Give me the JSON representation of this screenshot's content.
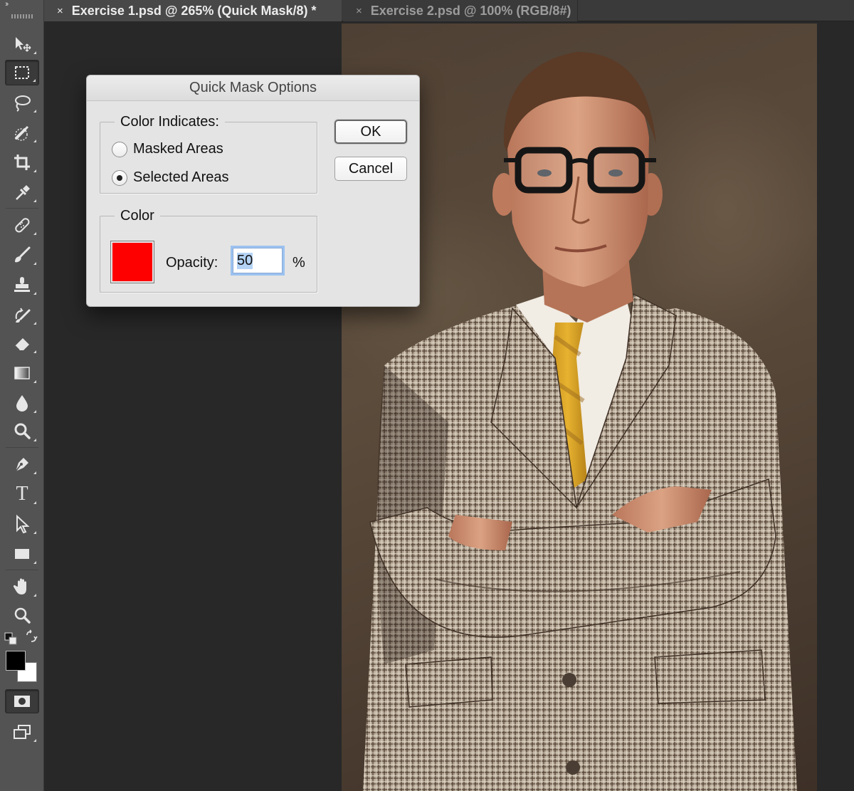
{
  "tabs": [
    {
      "title": "Exercise 1.psd @ 265% (Quick Mask/8) *",
      "close": "×",
      "active": true
    },
    {
      "title": "Exercise 2.psd @ 100% (RGB/8#)",
      "close": "×",
      "active": false
    }
  ],
  "toolbar": {
    "collapse": "››",
    "tools": [
      {
        "name": "move-icon"
      },
      {
        "name": "marquee-icon",
        "active": true
      },
      {
        "name": "lasso-icon"
      },
      {
        "name": "quick-selection-icon"
      },
      {
        "name": "crop-icon"
      },
      {
        "name": "eyedropper-icon"
      },
      {
        "name": "healing-brush-icon"
      },
      {
        "name": "brush-icon"
      },
      {
        "name": "clone-stamp-icon"
      },
      {
        "name": "history-brush-icon"
      },
      {
        "name": "eraser-icon"
      },
      {
        "name": "gradient-icon"
      },
      {
        "name": "blur-icon"
      },
      {
        "name": "dodge-icon"
      },
      {
        "name": "pen-icon"
      },
      {
        "name": "type-icon",
        "glyph": "T"
      },
      {
        "name": "path-selection-icon"
      },
      {
        "name": "rectangle-icon"
      },
      {
        "name": "hand-icon"
      },
      {
        "name": "zoom-icon"
      }
    ],
    "foreground_color": "#000000",
    "background_color": "#ffffff"
  },
  "dialog": {
    "title": "Quick Mask Options",
    "color_indicates": {
      "label": "Color Indicates:",
      "options": [
        {
          "label": "Masked Areas",
          "checked": false
        },
        {
          "label": "Selected Areas",
          "checked": true
        }
      ]
    },
    "color_group": {
      "label": "Color",
      "swatch_color": "#ff0000",
      "opacity_label": "Opacity:",
      "opacity_value": "50",
      "percent": "%"
    },
    "buttons": {
      "ok": "OK",
      "cancel": "Cancel"
    }
  }
}
